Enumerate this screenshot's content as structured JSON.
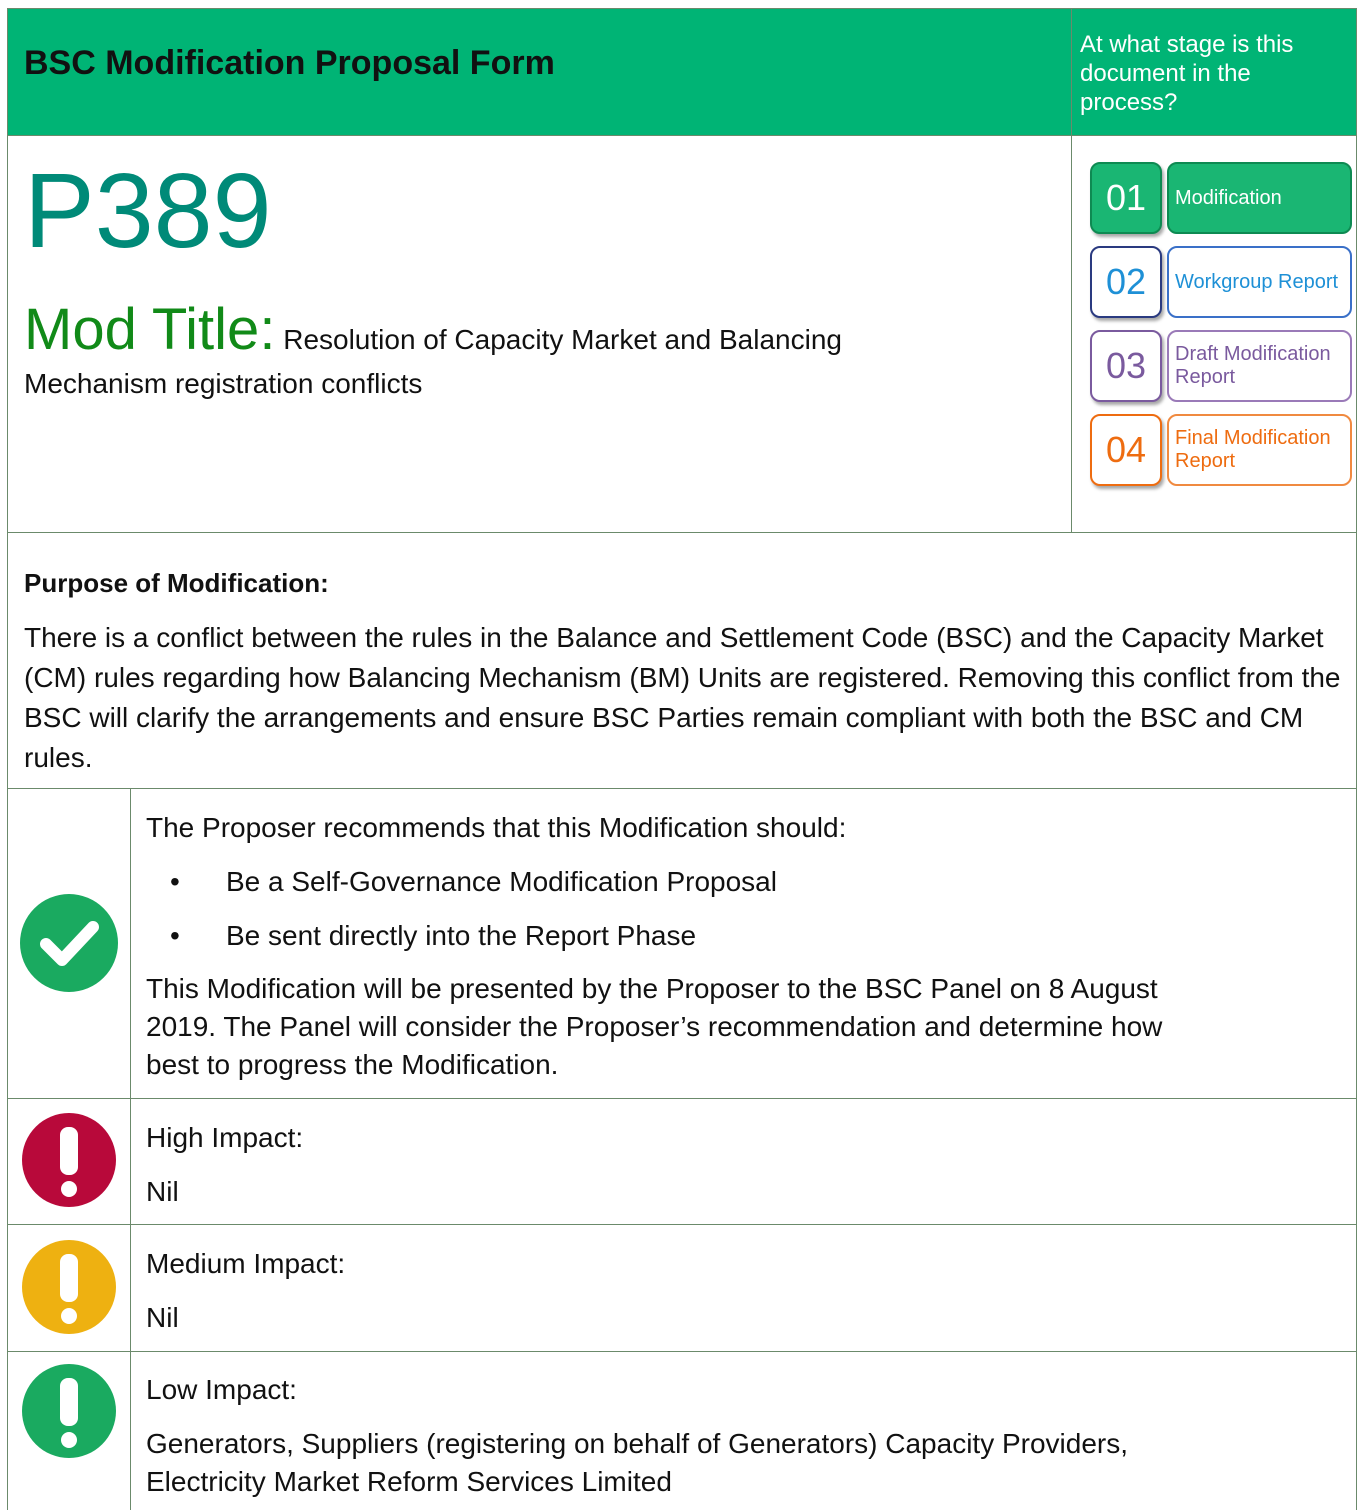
{
  "header": {
    "title": "BSC Modification Proposal Form",
    "stage_question": "At what stage is this document in the process?"
  },
  "modification": {
    "number": "P389",
    "title_label": "Mod Title:",
    "title_line1": " Resolution of Capacity Market and Balancing",
    "title_line2": "Mechanism registration conflicts"
  },
  "stages": [
    {
      "num": "01",
      "label": "Modification",
      "color": "#00b475"
    },
    {
      "num": "02",
      "label": "Workgroup Report",
      "color": "#1e90d6"
    },
    {
      "num": "03",
      "label": "Draft Modification Report",
      "color": "#7a5a9e"
    },
    {
      "num": "04",
      "label": "Final Modification Report",
      "color": "#ee6c10"
    }
  ],
  "purpose": {
    "heading": "Purpose of Modification:",
    "body": "There is a conflict between the rules in the Balance and Settlement Code (BSC) and the Capacity Market (CM) rules regarding how Balancing Mechanism (BM) Units are registered. Removing this conflict from the BSC will clarify the arrangements and ensure BSC Parties remain compliant with both the BSC and CM rules."
  },
  "recommendation": {
    "intro": "The Proposer recommends that this Modification should:",
    "bullets": [
      "Be a Self-Governance Modification Proposal",
      "Be sent directly into the Report Phase"
    ],
    "line1": "This Modification will be presented by the Proposer to the BSC Panel on 8 August",
    "line2": "2019. The Panel will consider the Proposer’s recommendation and determine how",
    "line3": "best to progress the Modification."
  },
  "impacts": {
    "high": {
      "label": "High Impact:",
      "value": "Nil",
      "color": "#b8093a"
    },
    "medium": {
      "label": "Medium Impact:",
      "value": "Nil",
      "color": "#eeb111"
    },
    "low": {
      "label": "Low Impact:",
      "line1": "Generators, Suppliers (registering on behalf of Generators) Capacity Providers,",
      "line2": "Electricity Market Reform Services Limited",
      "color": "#1aaa60"
    }
  },
  "icons": {
    "check": "check-circle-icon",
    "alert": "exclamation-circle-icon"
  }
}
